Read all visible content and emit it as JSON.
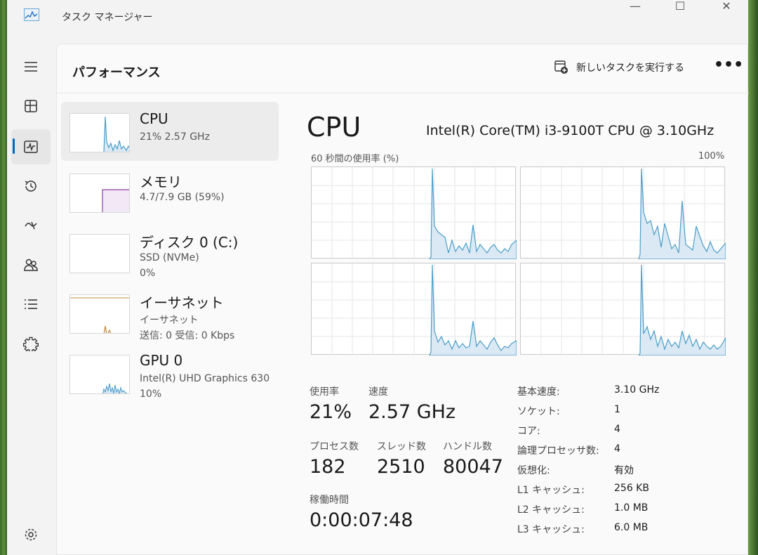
{
  "window": {
    "title": "タスク マネージャー",
    "controls": {
      "minimize": "—",
      "maximize": "☐",
      "close": "✕"
    }
  },
  "nav": {
    "items": [
      "hamburger-icon",
      "processes-icon",
      "performance-icon",
      "app-history-icon",
      "startup-icon",
      "users-icon",
      "details-icon",
      "services-icon",
      "settings-icon"
    ],
    "active": "performance-icon"
  },
  "header": {
    "title": "パフォーマンス",
    "run_task": "新しいタスクを実行する",
    "more": "•••"
  },
  "resources": [
    {
      "name": "CPU",
      "line1": "21%  2.57 GHz",
      "line2": ""
    },
    {
      "name": "メモリ",
      "line1": "4.7/7.9 GB (59%)",
      "line2": ""
    },
    {
      "name": "ディスク 0 (C:)",
      "line1": "SSD (NVMe)",
      "line2": "0%"
    },
    {
      "name": "イーサネット",
      "line1": "イーサネット",
      "line2": "送信: 0  受信: 0 Kbps"
    },
    {
      "name": "GPU 0",
      "line1": "Intel(R) UHD Graphics 630",
      "line2": "10%"
    }
  ],
  "detail": {
    "title": "CPU",
    "model": "Intel(R) Core(TM) i3-9100T CPU @ 3.10GHz",
    "graph_label": "60 秒間の使用率 (%)",
    "graph_max": "100%",
    "stats": {
      "utilization_label": "使用率",
      "utilization": "21%",
      "speed_label": "速度",
      "speed": "2.57 GHz",
      "processes_label": "プロセス数",
      "processes": "182",
      "threads_label": "スレッド数",
      "threads": "2510",
      "handles_label": "ハンドル数",
      "handles": "80047",
      "uptime_label": "稼働時間",
      "uptime": "0:00:07:48"
    },
    "specs": [
      {
        "label": "基本速度:",
        "value": "3.10 GHz"
      },
      {
        "label": "ソケット:",
        "value": "1"
      },
      {
        "label": "コア:",
        "value": "4"
      },
      {
        "label": "論理プロセッサ数:",
        "value": "4"
      },
      {
        "label": "仮想化:",
        "value": "有効"
      },
      {
        "label": "L1 キャッシュ:",
        "value": "256 KB"
      },
      {
        "label": "L2 キャッシュ:",
        "value": "1.0 MB"
      },
      {
        "label": "L3 キャッシュ:",
        "value": "6.0 MB"
      }
    ]
  },
  "colors": {
    "accent": "#0067c0",
    "cpu_line": "#4a9dc9",
    "cpu_fill": "#dbe9f4",
    "memory_line": "#8b3fa0"
  }
}
